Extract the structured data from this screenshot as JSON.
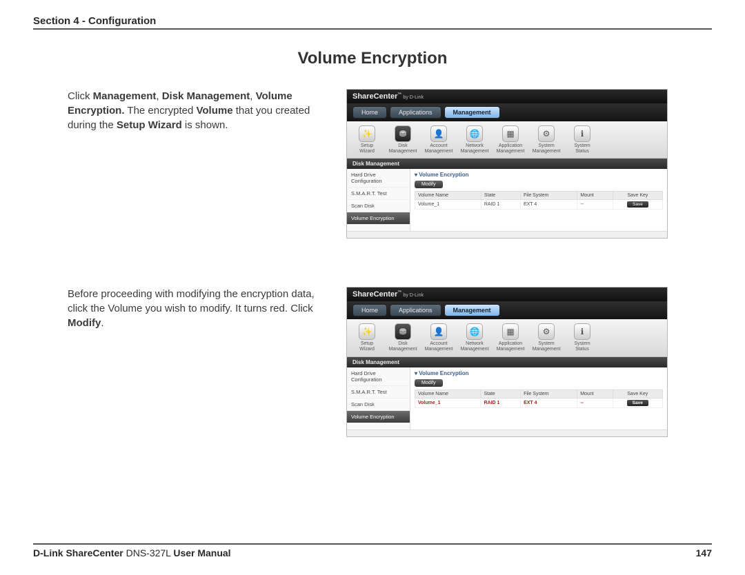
{
  "header": "Section 4 - Configuration",
  "title": "Volume Encryption",
  "step1": {
    "pre": "Click ",
    "b1": "Management",
    "sep1": ", ",
    "b2": "Disk Management",
    "sep2": ", ",
    "b3": "Volume Encryption.",
    "post1": " The encrypted ",
    "b4": "Volume",
    "post2": " that you created during the ",
    "b5": "Setup Wizard",
    "post3": " is shown."
  },
  "step2": {
    "pre": "Before proceeding with modifying the encryption data, click the Volume you wish to modify. It turns red. Click ",
    "b1": "Modify",
    "post": "."
  },
  "ui": {
    "brand": "ShareCenter",
    "brand_sub": "by D-Link",
    "nav": {
      "home": "Home",
      "apps": "Applications",
      "mgmt": "Management"
    },
    "toolbar": {
      "setup": "Setup Wizard",
      "disk": "Disk Management",
      "account": "Account Management",
      "network": "Network Management",
      "app": "Application Management",
      "system": "System Management",
      "status": "System Status"
    },
    "section": "Disk Management",
    "side": {
      "hdc": "Hard Drive Configuration",
      "smart": "S.M.A.R.T. Test",
      "scan": "Scan Disk",
      "venc": "Volume Encryption"
    },
    "main": {
      "heading": "Volume Encryption",
      "modify": "Modify",
      "cols": {
        "name": "Volume Name",
        "state": "State",
        "fs": "File System",
        "mount": "Mount",
        "savekey": "Save Key"
      },
      "row": {
        "name": "Volume_1",
        "state": "RAID 1",
        "fs": "EXT 4",
        "mount": "--",
        "savekey": "Save"
      }
    }
  },
  "footer": {
    "brand": "D-Link ShareCenter",
    "model": " DNS-327L ",
    "tail": "User Manual",
    "page": "147"
  }
}
